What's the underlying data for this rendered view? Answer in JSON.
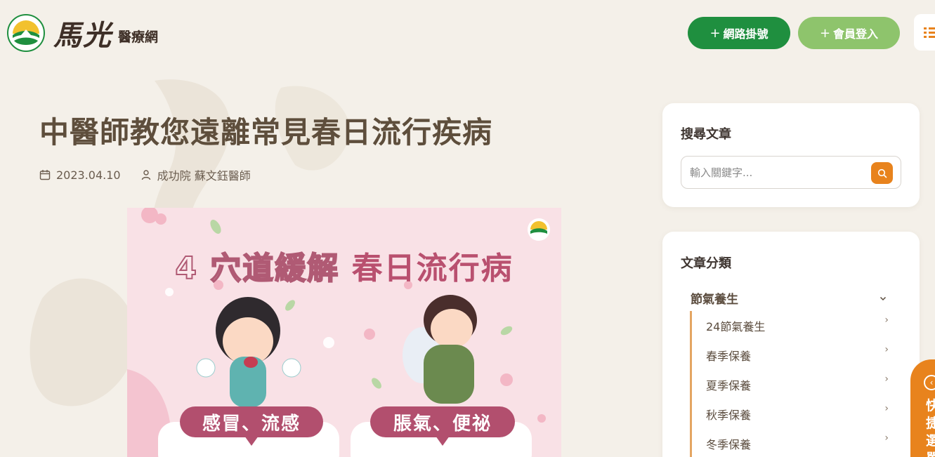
{
  "header": {
    "logo_brand": "馬光",
    "logo_sub": "醫療網",
    "register_button": "網路掛號",
    "login_button": "會員登入",
    "plus": "+"
  },
  "article": {
    "title": "中醫師教您遠離常見春日流行疾病",
    "date": "2023.04.10",
    "author": "成功院 蘇文鈺醫師"
  },
  "hero": {
    "title_prefix": "4 穴道緩解",
    "title_main": "春日流行病",
    "label_left": "感冒、流感",
    "label_right": "脹氣、便祕"
  },
  "sidebar": {
    "search_title": "搜尋文章",
    "search_placeholder": "輸入關鍵字...",
    "category_title": "文章分類",
    "category_head": "節氣養生",
    "sub_items": [
      {
        "label": "24節氣養生"
      },
      {
        "label": "春季保養"
      },
      {
        "label": "夏季保養"
      },
      {
        "label": "秋季保養"
      },
      {
        "label": "冬季保養"
      }
    ]
  },
  "float_tab": {
    "text": "快捷選單"
  },
  "colors": {
    "background": "#f4f0e9",
    "primary_green": "#1f8f3f",
    "light_green": "#8ec46c",
    "accent_orange": "#e8831d",
    "hero_pink": "#f9e1e6",
    "hero_rose": "#b24f6e"
  }
}
